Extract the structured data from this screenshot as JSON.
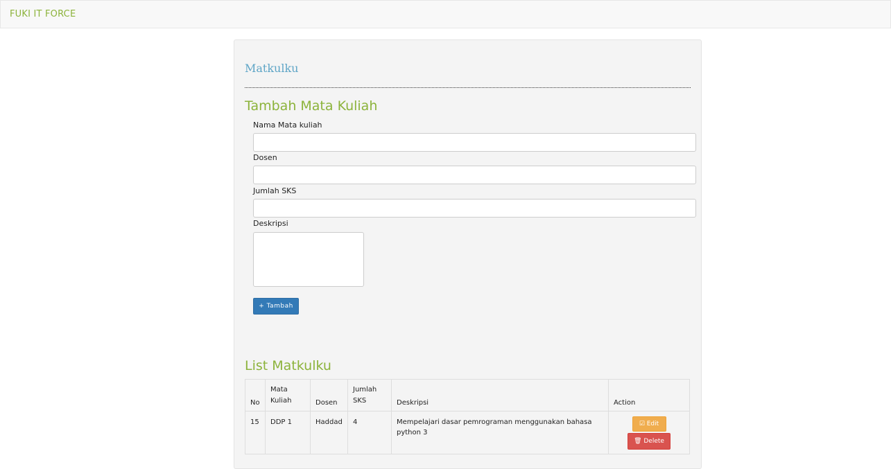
{
  "navbar": {
    "brand": "FUKI IT FORCE"
  },
  "page": {
    "title": "Matkulku"
  },
  "form": {
    "title": "Tambah Mata Kuliah",
    "fields": [
      {
        "label": "Nama Mata kuliah",
        "value": ""
      },
      {
        "label": "Dosen",
        "value": ""
      },
      {
        "label": "Jumlah SKS",
        "value": ""
      },
      {
        "label": "Deskripsi",
        "value": ""
      }
    ],
    "submit_label": "+ Tambah"
  },
  "list": {
    "title": "List Matkulku",
    "columns": [
      "No",
      "Mata Kuliah",
      "Dosen",
      "Jumlah SKS",
      "Deskripsi",
      "Action"
    ],
    "rows": [
      {
        "no": "15",
        "mata_kuliah": "DDP 1",
        "dosen": "Haddad",
        "sks": "4",
        "deskripsi": "Mempelajari dasar pemrograman menggunakan bahasa python 3",
        "edit_label": "Edit",
        "delete_label": "Delete"
      }
    ]
  },
  "colors": {
    "brand": "#8cb33b",
    "title": "#5ea5c6",
    "primary": "#337ab7",
    "warning": "#f0ad4e",
    "danger": "#d9534f"
  }
}
